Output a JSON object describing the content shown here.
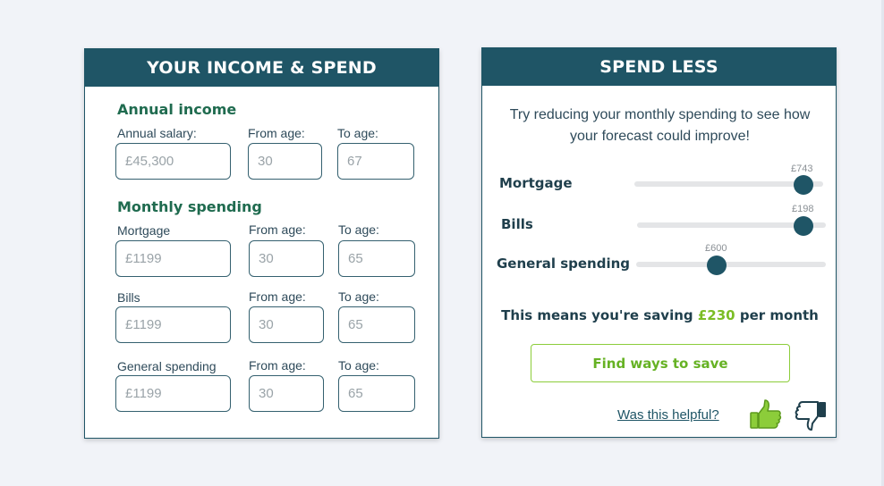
{
  "income_card": {
    "title": "YOUR INCOME & SPEND",
    "annual_income": {
      "section_title": "Annual income",
      "salary_label": "Annual salary:",
      "salary_value": "£45,300",
      "from_label": "From age:",
      "from_value": "30",
      "to_label": "To age:",
      "to_value": "67"
    },
    "monthly_spending": {
      "section_title": "Monthly spending",
      "rows": [
        {
          "label": "Mortgage",
          "value": "£1199",
          "from_label": "From age:",
          "from_value": "30",
          "to_label": "To age:",
          "to_value": "65"
        },
        {
          "label": "Bills",
          "value": "£1199",
          "from_label": "From age:",
          "from_value": "30",
          "to_label": "To age:",
          "to_value": "65"
        },
        {
          "label": "General spending",
          "value": "£1199",
          "from_label": "From age:",
          "from_value": "30",
          "to_label": "To age:",
          "to_value": "65"
        }
      ]
    }
  },
  "spend_card": {
    "title": "SPEND LESS",
    "intro": "Try reducing your monthly spending to see how your forecast could improve!",
    "sliders": [
      {
        "label": "Mortgage",
        "value_label": "£743",
        "level": 0.9
      },
      {
        "label": "Bills",
        "value_label": "£198",
        "level": 0.9
      },
      {
        "label": "General spending",
        "value_label": "£600",
        "level": 0.43
      }
    ],
    "saving_prefix": "This means you're saving ",
    "saving_amount": "£230",
    "saving_suffix": " per month",
    "find_button": "Find ways to save",
    "helpful_text": "Was this helpful?"
  },
  "colors": {
    "header": "#1f5566",
    "section_title": "#1f6b4f",
    "accent_green": "#7bbd25",
    "slider_thumb": "#1f5566"
  },
  "icons": [
    "thumbs-up-icon",
    "thumbs-down-icon"
  ]
}
